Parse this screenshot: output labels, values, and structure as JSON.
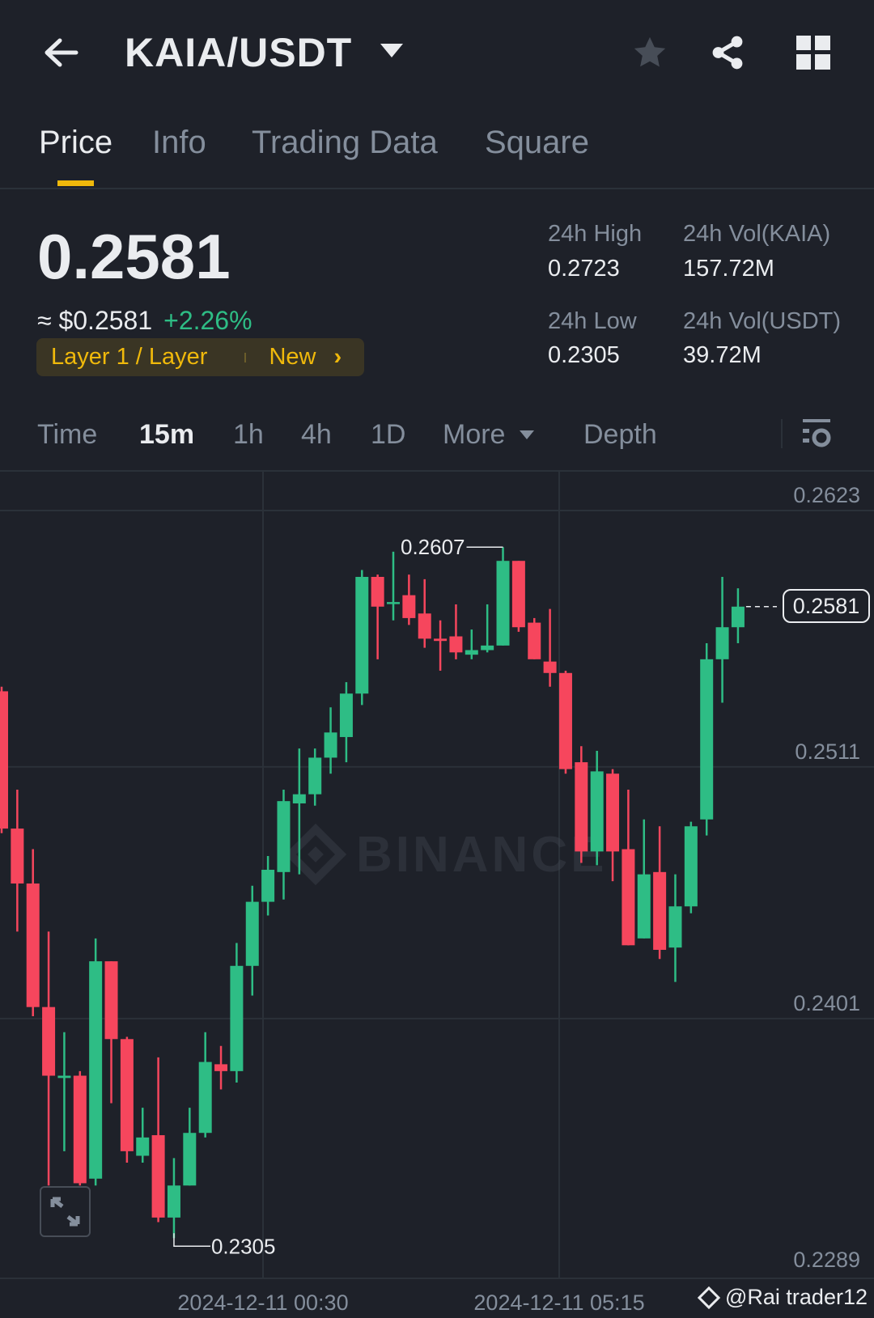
{
  "header": {
    "title": "KAIA/USDT"
  },
  "tabs": [
    {
      "label": "Price"
    },
    {
      "label": "Info"
    },
    {
      "label": "Trading Data"
    },
    {
      "label": "Square"
    }
  ],
  "ticker": {
    "last_price": "0.2581",
    "fiat_price": "≈ $0.2581",
    "change": "+2.26%",
    "tag": "Layer 1 / Layer",
    "tag_badge": "New"
  },
  "stats": {
    "high_label": "24h High",
    "high": "0.2723",
    "low_label": "24h Low",
    "low": "0.2305",
    "vol_base_label": "24h Vol(KAIA)",
    "vol_base": "157.72M",
    "vol_quote_label": "24h Vol(USDT)",
    "vol_quote": "39.72M"
  },
  "timeframes": [
    {
      "label": "Time"
    },
    {
      "label": "15m"
    },
    {
      "label": "1h"
    },
    {
      "label": "4h"
    },
    {
      "label": "1D"
    },
    {
      "label": "More"
    },
    {
      "label": "Depth"
    }
  ],
  "colors": {
    "up": "#2ebd85",
    "down": "#f6465d",
    "accent": "#f0b90b"
  },
  "watermark": "BINANCE",
  "credit": "@Rai trader12",
  "chart_data": {
    "type": "candlestick",
    "interval": "15m",
    "ylim": [
      0.2289,
      0.2623
    ],
    "y_ticks": [
      "0.2623",
      "0.2511",
      "0.2401",
      "0.2289"
    ],
    "x_ticks": [
      "2024-12-11 00:30",
      "2024-12-11 05:15"
    ],
    "max_label": "0.2607",
    "min_label": "0.2305",
    "last_label": "0.2581",
    "candles": [
      [
        0.2544,
        0.2546,
        0.2482,
        0.2484
      ],
      [
        0.2484,
        0.2501,
        0.2439,
        0.246
      ],
      [
        0.246,
        0.2475,
        0.2402,
        0.2406
      ],
      [
        0.2406,
        0.2439,
        0.2328,
        0.2376
      ],
      [
        0.2375,
        0.2395,
        0.2343,
        0.2376
      ],
      [
        0.2376,
        0.2378,
        0.2328,
        0.2329
      ],
      [
        0.2331,
        0.2436,
        0.2328,
        0.2426
      ],
      [
        0.2426,
        0.2426,
        0.2364,
        0.2392
      ],
      [
        0.2392,
        0.2393,
        0.2338,
        0.2343
      ],
      [
        0.2341,
        0.2362,
        0.2338,
        0.2349
      ],
      [
        0.235,
        0.2384,
        0.2312,
        0.2314
      ],
      [
        0.2314,
        0.234,
        0.2305,
        0.2328
      ],
      [
        0.2328,
        0.2362,
        0.2328,
        0.2351
      ],
      [
        0.2351,
        0.2395,
        0.2349,
        0.2382
      ],
      [
        0.2381,
        0.2389,
        0.237,
        0.2378
      ],
      [
        0.2378,
        0.2434,
        0.2373,
        0.2424
      ],
      [
        0.2424,
        0.2459,
        0.2411,
        0.2452
      ],
      [
        0.2452,
        0.2472,
        0.2446,
        0.2466
      ],
      [
        0.2465,
        0.2501,
        0.2453,
        0.2496
      ],
      [
        0.2495,
        0.2519,
        0.2464,
        0.2499
      ],
      [
        0.2499,
        0.2519,
        0.2494,
        0.2515
      ],
      [
        0.2515,
        0.2537,
        0.2508,
        0.2526
      ],
      [
        0.2524,
        0.2548,
        0.2513,
        0.2543
      ],
      [
        0.2543,
        0.2597,
        0.2538,
        0.2594
      ],
      [
        0.2594,
        0.2595,
        0.2558,
        0.2581
      ],
      [
        0.2583,
        0.2605,
        0.2575,
        0.2583
      ],
      [
        0.2586,
        0.2595,
        0.2573,
        0.2576
      ],
      [
        0.2578,
        0.2593,
        0.2563,
        0.2567
      ],
      [
        0.2567,
        0.2575,
        0.2553,
        0.2566
      ],
      [
        0.2568,
        0.2582,
        0.2558,
        0.2561
      ],
      [
        0.256,
        0.2571,
        0.2558,
        0.2562
      ],
      [
        0.2562,
        0.2582,
        0.2561,
        0.2564
      ],
      [
        0.2564,
        0.2607,
        0.2564,
        0.2601
      ],
      [
        0.2601,
        0.2601,
        0.257,
        0.2572
      ],
      [
        0.2574,
        0.2576,
        0.2558,
        0.2558
      ],
      [
        0.2557,
        0.258,
        0.2546,
        0.2552
      ],
      [
        0.2552,
        0.2553,
        0.2508,
        0.251
      ],
      [
        0.2513,
        0.252,
        0.2469,
        0.2474
      ],
      [
        0.2474,
        0.2518,
        0.2468,
        0.2509
      ],
      [
        0.2508,
        0.251,
        0.2461,
        0.2474
      ],
      [
        0.2475,
        0.2501,
        0.2433,
        0.2433
      ],
      [
        0.2436,
        0.2488,
        0.2436,
        0.2464
      ],
      [
        0.2465,
        0.2485,
        0.2427,
        0.2431
      ],
      [
        0.2432,
        0.2464,
        0.2417,
        0.245
      ],
      [
        0.245,
        0.2487,
        0.2447,
        0.2485
      ],
      [
        0.2488,
        0.2565,
        0.2481,
        0.2558
      ],
      [
        0.2558,
        0.2594,
        0.2539,
        0.2572
      ],
      [
        0.2572,
        0.2589,
        0.2565,
        0.2581
      ]
    ]
  }
}
